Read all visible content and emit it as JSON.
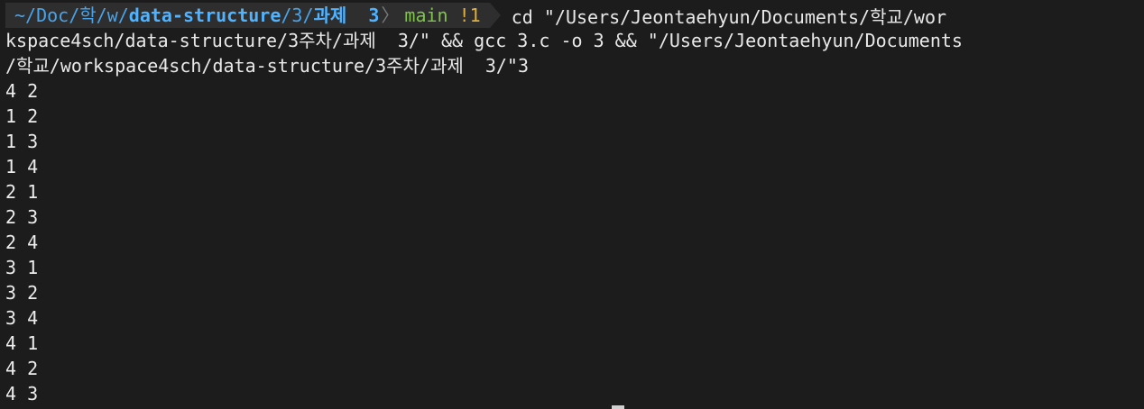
{
  "prompt": {
    "path_parts": [
      {
        "text": "~/Doc/",
        "style": "dim"
      },
      {
        "text": "학",
        "style": "dim"
      },
      {
        "text": "/w/",
        "style": "dim"
      },
      {
        "text": "data-structure",
        "style": "bold"
      },
      {
        "text": "/3/",
        "style": "dim"
      },
      {
        "text": "과제  3",
        "style": "bold"
      }
    ],
    "git_branch": "main",
    "git_status": "!1",
    "command": "cd \"/Users/Jeontaehyun/Documents/학교/wor"
  },
  "command_wrap": [
    "kspace4sch/data-structure/3주차/과제  3/\" && gcc 3.c -o 3 && \"/Users/Jeontaehyun/Documents",
    "/학교/workspace4sch/data-structure/3주차/과제  3/\"3"
  ],
  "output_lines": [
    "4 2",
    "1 2",
    "1 3",
    "1 4",
    "2 1",
    "2 3",
    "2 4",
    "3 1",
    "3 2",
    "3 4",
    "4 1",
    "4 2",
    "4 3"
  ],
  "colors": {
    "background": "#1c1c1c",
    "path": "#4aa3e8",
    "branch": "#7fc44a",
    "git_status": "#e0b03a",
    "text": "#e8e8e8"
  }
}
